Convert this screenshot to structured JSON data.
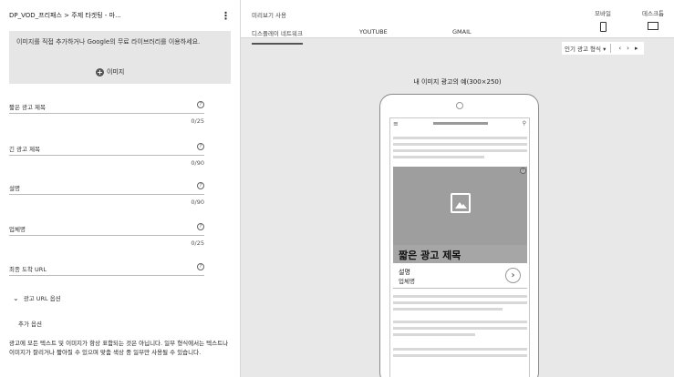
{
  "left": {
    "header_title": "DP_VOD_프리패스 > 주제 타겟팅 - 마...",
    "image_box": {
      "message": "이미지를 직접 추가하거나 Google의 무료 라이브러리를 이용하세요.",
      "button_label": "이미지"
    },
    "fields": [
      {
        "label": "짧은 광고 제목",
        "count": "0/25"
      },
      {
        "label": "긴 광고 제목",
        "count": "0/90"
      },
      {
        "label": "설명",
        "count": "0/90"
      },
      {
        "label": "업체명",
        "count": "0/25"
      },
      {
        "label": "최종 도착 URL",
        "count": ""
      }
    ],
    "url_options_label": "광고 URL 옵션",
    "more_options_label": "추가 옵션",
    "note": "광고에 모든 텍스트 및 이미지가 항상 표함되는 것은 아닙니다. 일부 형식에서는 텍스트나 이미지가 잘리거나 짧아질 수 있으며 맞춤 색상 중 일부만 사용될 수 있습니다."
  },
  "preview": {
    "title": "미리보기 사용",
    "tabs": [
      {
        "label": "디스플레이 네트워크",
        "active": true
      },
      {
        "label": "YOUTUBE",
        "active": false
      },
      {
        "label": "GMAIL",
        "active": false
      }
    ],
    "devices": [
      {
        "label": "모바일",
        "icon": "phone-icon"
      },
      {
        "label": "데스크톱",
        "icon": "monitor-icon"
      }
    ],
    "format_select": "인기 광고 형식",
    "example_caption": "내 이미지 광고의 예(300×250)",
    "ad": {
      "short_title": "짧은 광고 제목",
      "description": "설명",
      "business_name": "업체명",
      "info_icon": "info-icon",
      "arrow_icon": "chevron-right-icon"
    }
  }
}
